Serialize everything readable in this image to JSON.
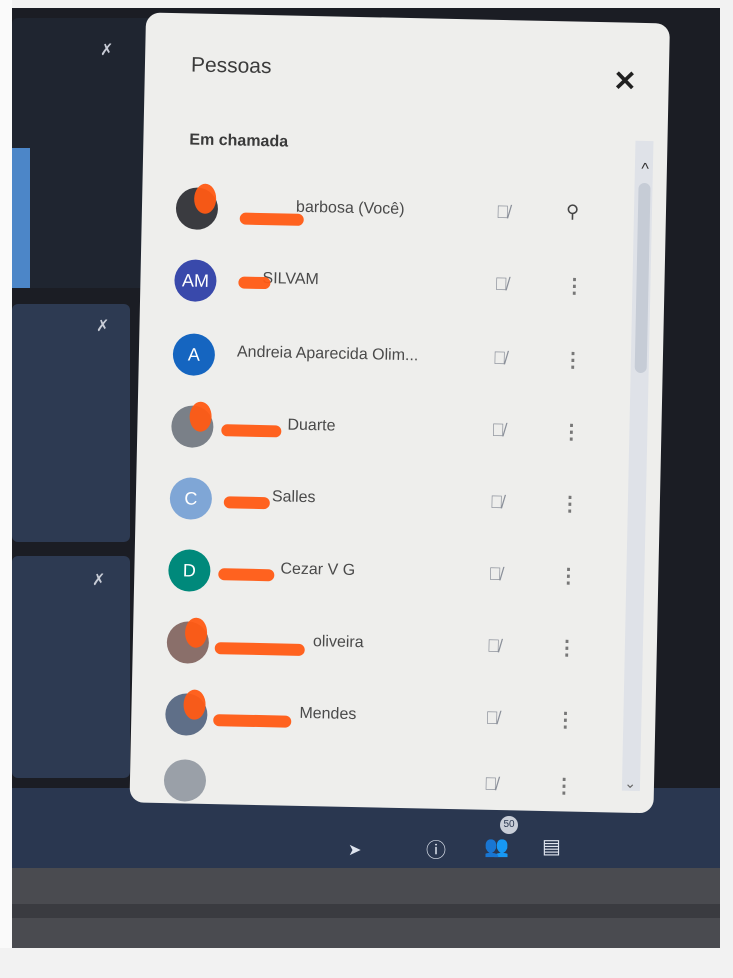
{
  "panel": {
    "title": "Pessoas",
    "close_symbol": "✕",
    "section": "Em chamada"
  },
  "participants": [
    {
      "avatar_text": "",
      "name": "barbosa (Você)",
      "action": "pin-icon",
      "avatar_color": "#3a3b40"
    },
    {
      "avatar_text": "AM",
      "name": "SILVAM",
      "action": "more-options-icon",
      "avatar_color": "#3949ab"
    },
    {
      "avatar_text": "A",
      "name": "Andreia Aparecida Olim...",
      "action": "more-options-icon",
      "avatar_color": "#1565c0"
    },
    {
      "avatar_text": "",
      "name": "Duarte",
      "action": "more-options-icon",
      "avatar_color": "#7a8088"
    },
    {
      "avatar_text": "C",
      "name": "Salles",
      "action": "more-options-icon",
      "avatar_color": "#7fa6d6"
    },
    {
      "avatar_text": "D",
      "name": "Cezar V G",
      "action": "more-options-icon",
      "avatar_color": "#00897b"
    },
    {
      "avatar_text": "",
      "name": "oliveira",
      "action": "more-options-icon",
      "avatar_color": "#8a6f6a"
    },
    {
      "avatar_text": "",
      "name": "Mendes",
      "action": "more-options-icon",
      "avatar_color": "#5f6f88"
    },
    {
      "avatar_text": "",
      "name": "",
      "action": "more-options-icon",
      "avatar_color": "#9aa0a8"
    }
  ],
  "icons": {
    "mic_off": "mic-off-icon",
    "pin": "pin-icon",
    "more": "more-options-icon"
  },
  "bottom_bar": {
    "people_count": "50"
  }
}
